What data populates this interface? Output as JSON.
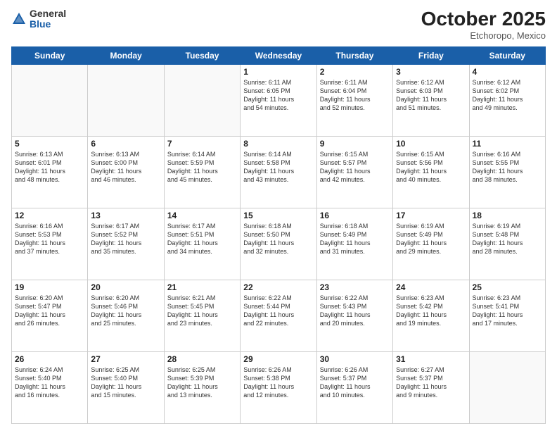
{
  "header": {
    "logo_general": "General",
    "logo_blue": "Blue",
    "month_title": "October 2025",
    "subtitle": "Etchoropo, Mexico"
  },
  "weekdays": [
    "Sunday",
    "Monday",
    "Tuesday",
    "Wednesday",
    "Thursday",
    "Friday",
    "Saturday"
  ],
  "weeks": [
    [
      {
        "day": "",
        "info": ""
      },
      {
        "day": "",
        "info": ""
      },
      {
        "day": "",
        "info": ""
      },
      {
        "day": "1",
        "info": "Sunrise: 6:11 AM\nSunset: 6:05 PM\nDaylight: 11 hours\nand 54 minutes."
      },
      {
        "day": "2",
        "info": "Sunrise: 6:11 AM\nSunset: 6:04 PM\nDaylight: 11 hours\nand 52 minutes."
      },
      {
        "day": "3",
        "info": "Sunrise: 6:12 AM\nSunset: 6:03 PM\nDaylight: 11 hours\nand 51 minutes."
      },
      {
        "day": "4",
        "info": "Sunrise: 6:12 AM\nSunset: 6:02 PM\nDaylight: 11 hours\nand 49 minutes."
      }
    ],
    [
      {
        "day": "5",
        "info": "Sunrise: 6:13 AM\nSunset: 6:01 PM\nDaylight: 11 hours\nand 48 minutes."
      },
      {
        "day": "6",
        "info": "Sunrise: 6:13 AM\nSunset: 6:00 PM\nDaylight: 11 hours\nand 46 minutes."
      },
      {
        "day": "7",
        "info": "Sunrise: 6:14 AM\nSunset: 5:59 PM\nDaylight: 11 hours\nand 45 minutes."
      },
      {
        "day": "8",
        "info": "Sunrise: 6:14 AM\nSunset: 5:58 PM\nDaylight: 11 hours\nand 43 minutes."
      },
      {
        "day": "9",
        "info": "Sunrise: 6:15 AM\nSunset: 5:57 PM\nDaylight: 11 hours\nand 42 minutes."
      },
      {
        "day": "10",
        "info": "Sunrise: 6:15 AM\nSunset: 5:56 PM\nDaylight: 11 hours\nand 40 minutes."
      },
      {
        "day": "11",
        "info": "Sunrise: 6:16 AM\nSunset: 5:55 PM\nDaylight: 11 hours\nand 38 minutes."
      }
    ],
    [
      {
        "day": "12",
        "info": "Sunrise: 6:16 AM\nSunset: 5:53 PM\nDaylight: 11 hours\nand 37 minutes."
      },
      {
        "day": "13",
        "info": "Sunrise: 6:17 AM\nSunset: 5:52 PM\nDaylight: 11 hours\nand 35 minutes."
      },
      {
        "day": "14",
        "info": "Sunrise: 6:17 AM\nSunset: 5:51 PM\nDaylight: 11 hours\nand 34 minutes."
      },
      {
        "day": "15",
        "info": "Sunrise: 6:18 AM\nSunset: 5:50 PM\nDaylight: 11 hours\nand 32 minutes."
      },
      {
        "day": "16",
        "info": "Sunrise: 6:18 AM\nSunset: 5:49 PM\nDaylight: 11 hours\nand 31 minutes."
      },
      {
        "day": "17",
        "info": "Sunrise: 6:19 AM\nSunset: 5:49 PM\nDaylight: 11 hours\nand 29 minutes."
      },
      {
        "day": "18",
        "info": "Sunrise: 6:19 AM\nSunset: 5:48 PM\nDaylight: 11 hours\nand 28 minutes."
      }
    ],
    [
      {
        "day": "19",
        "info": "Sunrise: 6:20 AM\nSunset: 5:47 PM\nDaylight: 11 hours\nand 26 minutes."
      },
      {
        "day": "20",
        "info": "Sunrise: 6:20 AM\nSunset: 5:46 PM\nDaylight: 11 hours\nand 25 minutes."
      },
      {
        "day": "21",
        "info": "Sunrise: 6:21 AM\nSunset: 5:45 PM\nDaylight: 11 hours\nand 23 minutes."
      },
      {
        "day": "22",
        "info": "Sunrise: 6:22 AM\nSunset: 5:44 PM\nDaylight: 11 hours\nand 22 minutes."
      },
      {
        "day": "23",
        "info": "Sunrise: 6:22 AM\nSunset: 5:43 PM\nDaylight: 11 hours\nand 20 minutes."
      },
      {
        "day": "24",
        "info": "Sunrise: 6:23 AM\nSunset: 5:42 PM\nDaylight: 11 hours\nand 19 minutes."
      },
      {
        "day": "25",
        "info": "Sunrise: 6:23 AM\nSunset: 5:41 PM\nDaylight: 11 hours\nand 17 minutes."
      }
    ],
    [
      {
        "day": "26",
        "info": "Sunrise: 6:24 AM\nSunset: 5:40 PM\nDaylight: 11 hours\nand 16 minutes."
      },
      {
        "day": "27",
        "info": "Sunrise: 6:25 AM\nSunset: 5:40 PM\nDaylight: 11 hours\nand 15 minutes."
      },
      {
        "day": "28",
        "info": "Sunrise: 6:25 AM\nSunset: 5:39 PM\nDaylight: 11 hours\nand 13 minutes."
      },
      {
        "day": "29",
        "info": "Sunrise: 6:26 AM\nSunset: 5:38 PM\nDaylight: 11 hours\nand 12 minutes."
      },
      {
        "day": "30",
        "info": "Sunrise: 6:26 AM\nSunset: 5:37 PM\nDaylight: 11 hours\nand 10 minutes."
      },
      {
        "day": "31",
        "info": "Sunrise: 6:27 AM\nSunset: 5:37 PM\nDaylight: 11 hours\nand 9 minutes."
      },
      {
        "day": "",
        "info": ""
      }
    ]
  ]
}
